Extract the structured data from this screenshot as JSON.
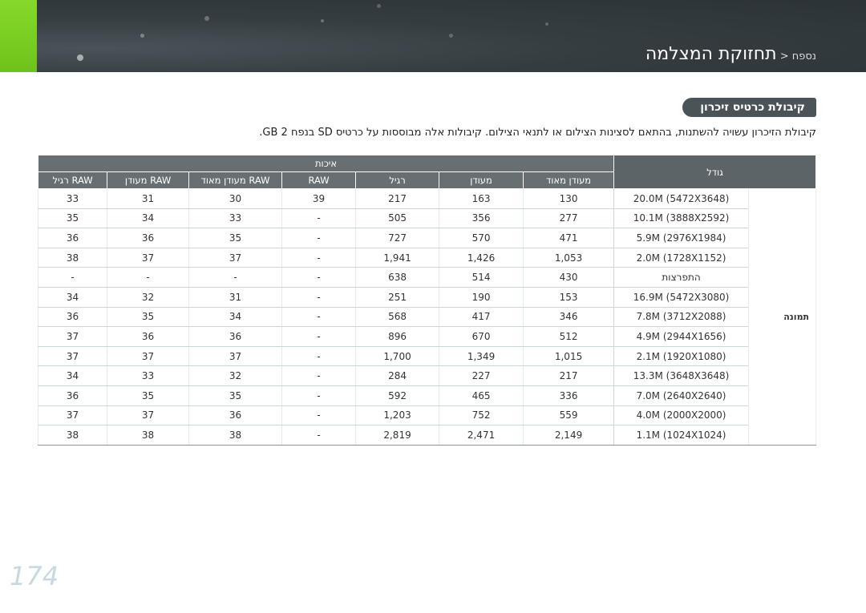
{
  "header": {
    "crumb": "נספח",
    "separator": " < ",
    "title": "תחזוקת המצלמה"
  },
  "section_title": "קיבולת כרטיס זיכרון",
  "description": "קיבולת הזיכרון עשויה להשתנות, בהתאם לסצינות הצילום או לתנאי הצילום. קיבולות אלה מבוססות על כרטיס SD בנפח 2 GB.",
  "table": {
    "header_type": "גודל",
    "header_quality": "איכות",
    "columns": [
      "מעודן מאוד",
      "מעודן",
      "רגיל",
      "RAW",
      "RAW מעודן מאוד",
      "RAW מעודן",
      "RAW רגיל"
    ],
    "row_group_label": "תמונה",
    "rows": [
      {
        "size": "20.0M (5472X3648)",
        "v": [
          "130",
          "163",
          "217",
          "39",
          "30",
          "31",
          "33"
        ]
      },
      {
        "size": "10.1M (3888X2592)",
        "v": [
          "277",
          "356",
          "505",
          "-",
          "33",
          "34",
          "35"
        ]
      },
      {
        "size": "5.9M (2976X1984)",
        "v": [
          "471",
          "570",
          "727",
          "-",
          "35",
          "36",
          "36"
        ]
      },
      {
        "size": "2.0M (1728X1152)",
        "v": [
          "1,053",
          "1,426",
          "1,941",
          "-",
          "37",
          "37",
          "38"
        ]
      },
      {
        "size": "התפרצות",
        "v": [
          "430",
          "514",
          "638",
          "-",
          "-",
          "-",
          "-"
        ]
      },
      {
        "size": "16.9M (5472X3080)",
        "v": [
          "153",
          "190",
          "251",
          "-",
          "31",
          "32",
          "34"
        ]
      },
      {
        "size": "7.8M (3712X2088)",
        "v": [
          "346",
          "417",
          "568",
          "-",
          "34",
          "35",
          "36"
        ]
      },
      {
        "size": "4.9M (2944X1656)",
        "v": [
          "512",
          "670",
          "896",
          "-",
          "36",
          "36",
          "37"
        ]
      },
      {
        "size": "2.1M (1920X1080)",
        "v": [
          "1,015",
          "1,349",
          "1,700",
          "-",
          "37",
          "37",
          "37"
        ]
      },
      {
        "size": "13.3M (3648X3648)",
        "v": [
          "217",
          "227",
          "284",
          "-",
          "32",
          "33",
          "34"
        ]
      },
      {
        "size": "7.0M (2640X2640)",
        "v": [
          "336",
          "465",
          "592",
          "-",
          "35",
          "35",
          "36"
        ]
      },
      {
        "size": "4.0M (2000X2000)",
        "v": [
          "559",
          "752",
          "1,203",
          "-",
          "36",
          "37",
          "37"
        ]
      },
      {
        "size": "1.1M (1024X1024)",
        "v": [
          "2,149",
          "2,471",
          "2,819",
          "-",
          "38",
          "38",
          "38"
        ]
      }
    ]
  },
  "page_number": "174",
  "colors": {
    "accent_green": "#7ed321",
    "header_bg": "#353d41",
    "table_header": "#676f72"
  }
}
